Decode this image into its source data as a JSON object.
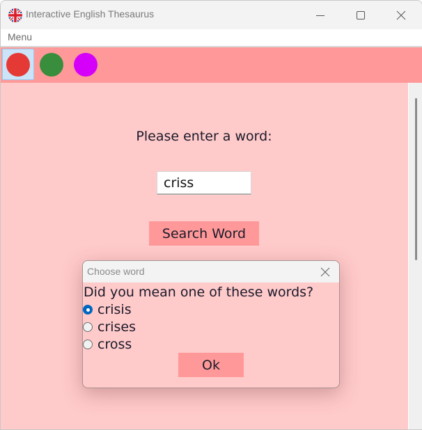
{
  "window": {
    "title": "Interactive English Thesaurus",
    "app_icon": "uk-flag-icon",
    "controls": [
      "minimize-icon",
      "maximize-icon",
      "close-icon"
    ]
  },
  "menubar": {
    "items": [
      {
        "label": "Menu"
      }
    ]
  },
  "toolbar": {
    "theme_buttons": [
      {
        "name": "red-theme",
        "color": "#e53935",
        "selected": true
      },
      {
        "name": "green-theme",
        "color": "#388e3c",
        "selected": false
      },
      {
        "name": "magenta-theme",
        "color": "#d500f9",
        "selected": false
      }
    ]
  },
  "main": {
    "prompt": "Please enter a word:",
    "word_input_value": "criss",
    "search_button_label": "Search Word"
  },
  "dialog": {
    "title": "Choose word",
    "question": "Did you mean one of these words?",
    "options": [
      {
        "label": "crisis",
        "checked": true
      },
      {
        "label": "crises",
        "checked": false
      },
      {
        "label": "cross",
        "checked": false
      }
    ],
    "ok_label": "Ok"
  },
  "colors": {
    "toolbar_bg": "#ff9999",
    "content_bg": "#ffcaca",
    "button_bg": "#ff9999",
    "radio_checked": "#0067c0"
  }
}
